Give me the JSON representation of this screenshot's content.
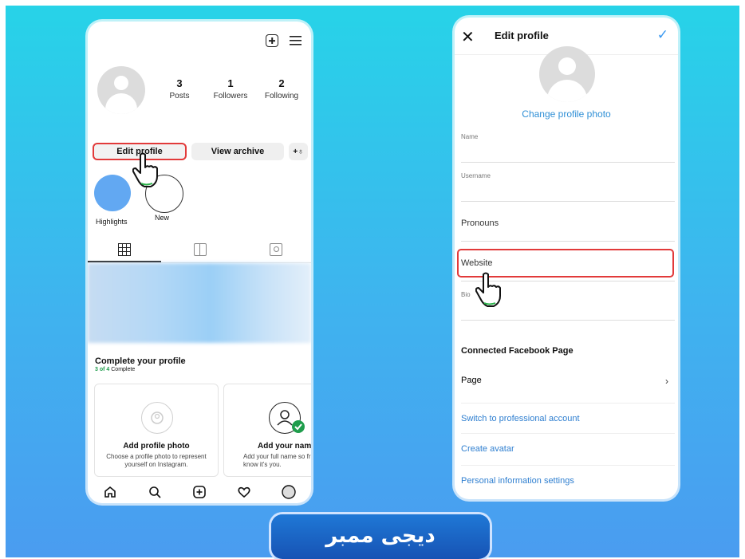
{
  "left_phone": {
    "stats": [
      {
        "num": "3",
        "label": "Posts"
      },
      {
        "num": "1",
        "label": "Followers"
      },
      {
        "num": "2",
        "label": "Following"
      }
    ],
    "buttons": {
      "edit": "Edit profile",
      "archive": "View archive",
      "add_user": "+♁"
    },
    "highlights": [
      {
        "label": "Highlights"
      },
      {
        "label": "New"
      }
    ],
    "complete": {
      "title": "Complete your profile",
      "progress_strong": "3 of 4",
      "progress_rest": "Complete"
    },
    "cards": [
      {
        "title": "Add profile photo",
        "desc": "Choose a profile photo to represent yourself on Instagram."
      },
      {
        "title": "Add your name",
        "desc": "Add your full name so friends know it's you."
      }
    ],
    "nav_icons": [
      "home-icon",
      "search-icon",
      "new-post-icon",
      "heart-icon",
      "profile-icon"
    ]
  },
  "right_phone": {
    "title": "Edit profile",
    "change_photo": "Change profile photo",
    "fields": {
      "name": "Name",
      "username": "Username",
      "pronouns": "Pronouns",
      "website": "Website",
      "bio": "Bio"
    },
    "section_title": "Connected Facebook Page",
    "rows": {
      "page": "Page",
      "switch": "Switch to professional account",
      "avatar": "Create avatar",
      "personal": "Personal information settings"
    }
  },
  "brand": {
    "text": "دیجی ممبر"
  },
  "colors": {
    "accent_blue": "#3797f0",
    "highlight_red": "#e23a3a",
    "progress_green": "#1f9d4c"
  }
}
